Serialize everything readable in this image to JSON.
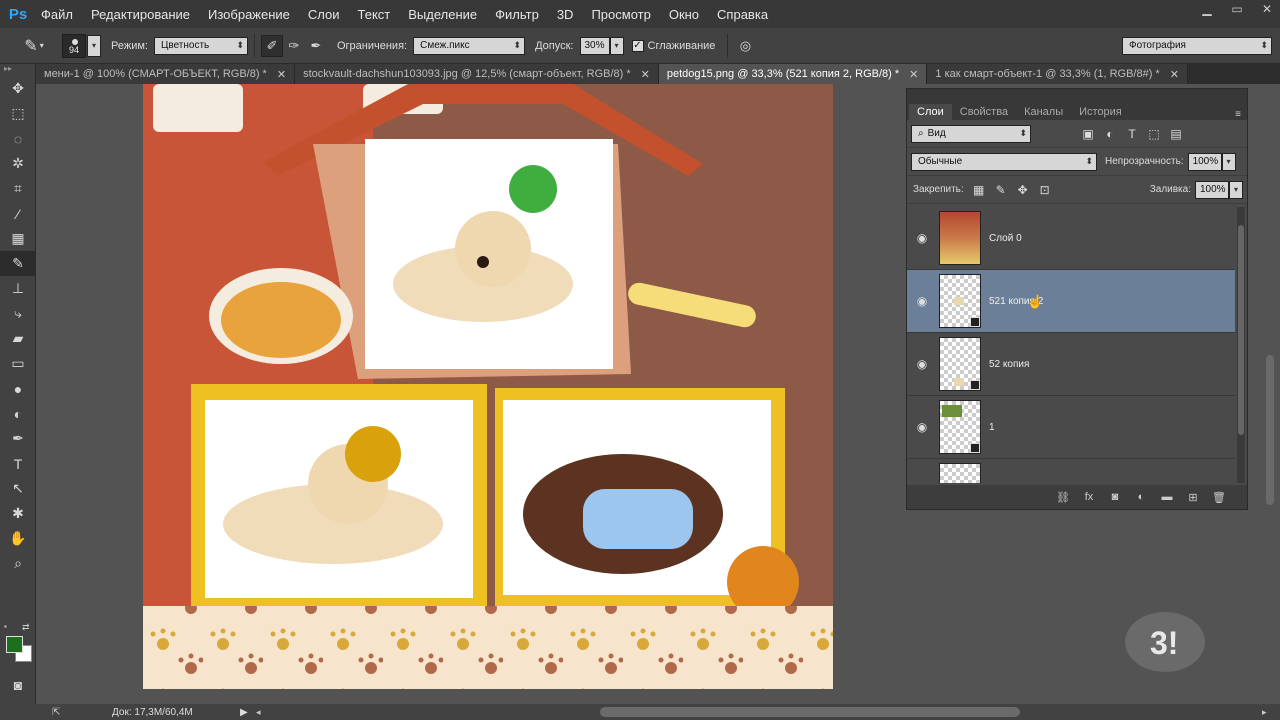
{
  "app": {
    "logo": "Ps"
  },
  "menu": [
    "Файл",
    "Редактирование",
    "Изображение",
    "Слои",
    "Текст",
    "Выделение",
    "Фильтр",
    "3D",
    "Просмотр",
    "Окно",
    "Справка"
  ],
  "window_controls": [
    "minimize-icon",
    "maximize-icon",
    "close-icon"
  ],
  "options": {
    "brush_size": "94",
    "mode_label": "Режим:",
    "mode_value": "Цветность",
    "limits_label": "Ограничения:",
    "limits_value": "Смеж.пикс",
    "tolerance_label": "Допуск:",
    "tolerance_value": "30%",
    "antialias_label": "Сглаживание",
    "antialias_checked": true,
    "workspace": "Фотография"
  },
  "tabs": [
    {
      "label": "мени-1 @ 100% (СМАРТ-ОБЪЕКТ, RGB/8) *",
      "active": false
    },
    {
      "label": "stockvault-dachshun103093.jpg @ 12,5% (смарт-объект, RGB/8) *",
      "active": false
    },
    {
      "label": "petdog15.png @ 33,3% (521 копия 2, RGB/8) *",
      "active": true
    },
    {
      "label": "1 как смарт-объект-1 @ 33,3% (1, RGB/8#) *",
      "active": false
    }
  ],
  "tools": [
    "move-tool",
    "marquee-tool",
    "lasso-tool",
    "magic-wand-tool",
    "crop-tool",
    "eyedropper-tool",
    "healing-tool",
    "brush-tool",
    "stamp-tool",
    "history-brush-tool",
    "eraser-tool",
    "gradient-tool",
    "blur-tool",
    "dodge-tool",
    "pen-tool",
    "type-tool",
    "path-select-tool",
    "shape-tool",
    "hand-tool",
    "zoom-tool"
  ],
  "status": {
    "doc_size": "Док: 17,3M/60,4M"
  },
  "layers_panel": {
    "tabs": [
      "Слои",
      "Свойства",
      "Каналы",
      "История"
    ],
    "active_tab": "Слои",
    "filter": "Вид",
    "blend_mode": "Обычные",
    "opacity_label": "Непрозрачность:",
    "opacity_value": "100%",
    "lock_label": "Закрепить:",
    "fill_label": "Заливка:",
    "fill_value": "100%",
    "layers": [
      {
        "name": "Слой 0",
        "selected": false,
        "visible": true
      },
      {
        "name": "521 копия 2",
        "selected": true,
        "visible": true
      },
      {
        "name": "52 копия",
        "selected": false,
        "visible": true
      },
      {
        "name": "1",
        "selected": false,
        "visible": true
      },
      {
        "name": "",
        "selected": false,
        "visible": false
      }
    ]
  },
  "colors": {
    "foreground": "#1c6f1b",
    "background": "#ffffff",
    "selection": "#6c7f98"
  }
}
